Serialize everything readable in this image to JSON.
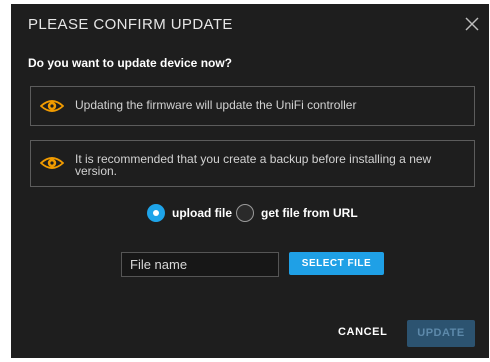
{
  "dialog": {
    "title": "PLEASE CONFIRM UPDATE",
    "question": "Do you want to update device now?"
  },
  "notices": [
    {
      "icon": "eye-icon",
      "text": "Updating the firmware will update the UniFi controller"
    },
    {
      "icon": "eye-icon",
      "text": "It is recommended that you create a backup before installing a new version."
    }
  ],
  "source_options": {
    "upload_label": "upload file",
    "url_label": "get file from URL",
    "selected": "upload file"
  },
  "file": {
    "placeholder": "File name",
    "select_label": "SELECT FILE"
  },
  "actions": {
    "cancel_label": "CANCEL",
    "update_label": "UPDATE"
  },
  "colors": {
    "accent": "#1ea4e9",
    "warning_icon": "#f19b00",
    "dialog_bg": "#1e1e1e",
    "update_disabled_bg": "#2c5370"
  }
}
